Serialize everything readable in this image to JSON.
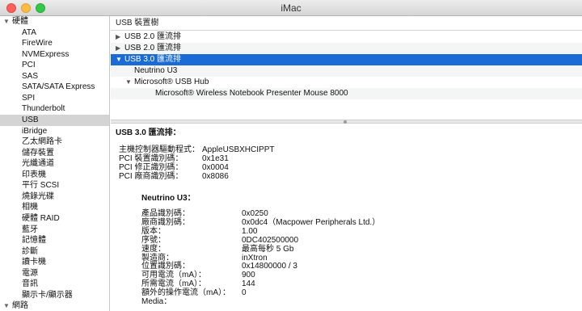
{
  "window": {
    "title": "iMac"
  },
  "sidebar": {
    "hardware_label": "硬體",
    "items": [
      "ATA",
      "FireWire",
      "NVMExpress",
      "PCI",
      "SAS",
      "SATA/SATA Express",
      "SPI",
      "Thunderbolt",
      "USB",
      "iBridge",
      "乙太網路卡",
      "儲存裝置",
      "光纖通道",
      "印表機",
      "平行 SCSI",
      "燒錄光碟",
      "相機",
      "硬體 RAID",
      "藍牙",
      "記憶體",
      "診斷",
      "讀卡機",
      "電源",
      "音訊",
      "顯示卡/顯示器"
    ],
    "selected_item": "USB",
    "network_label": "網路"
  },
  "tree": {
    "header": "USB 裝置樹",
    "rows": [
      {
        "label": "USB 2.0 匯流排",
        "expanded": false
      },
      {
        "label": "USB 2.0 匯流排",
        "expanded": false
      },
      {
        "label": "USB 3.0 匯流排",
        "expanded": true,
        "selected": true
      },
      {
        "label": "Neutrino U3"
      },
      {
        "label": "Microsoft® USB Hub",
        "expanded": true
      },
      {
        "label": "Microsoft® Wireless Notebook Presenter Mouse 8000"
      }
    ]
  },
  "detail": {
    "title": "USB 3.0 匯流排：",
    "bus_fields": [
      {
        "key": "主機控制器驅動程式：",
        "value": "AppleUSBXHCIPPT"
      },
      {
        "key": "PCI 裝置識別碼：",
        "value": "0x1e31"
      },
      {
        "key": "PCI 修正識別碼：",
        "value": "0x0004"
      },
      {
        "key": "PCI 廠商識別碼：",
        "value": "0x8086"
      }
    ],
    "device_title": "Neutrino U3：",
    "device_fields": [
      {
        "key": "產品識別碼：",
        "value": "0x0250"
      },
      {
        "key": "廠商識別碼：",
        "value": "0x0dc4（Macpower Peripherals Ltd.）"
      },
      {
        "key": "版本：",
        "value": "1.00"
      },
      {
        "key": "序號：",
        "value": "0DC402500000"
      },
      {
        "key": "速度：",
        "value": "最高每秒 5 Gb"
      },
      {
        "key": "製造商：",
        "value": "inXtron"
      },
      {
        "key": "位置識別碼：",
        "value": "0x14800000 / 3"
      },
      {
        "key": "可用電流（mA）：",
        "value": "900"
      },
      {
        "key": "所需電流（mA）：",
        "value": "144"
      },
      {
        "key": "額外的操作電流（mA）：",
        "value": "0"
      },
      {
        "key": "Media：",
        "value": ""
      }
    ]
  }
}
